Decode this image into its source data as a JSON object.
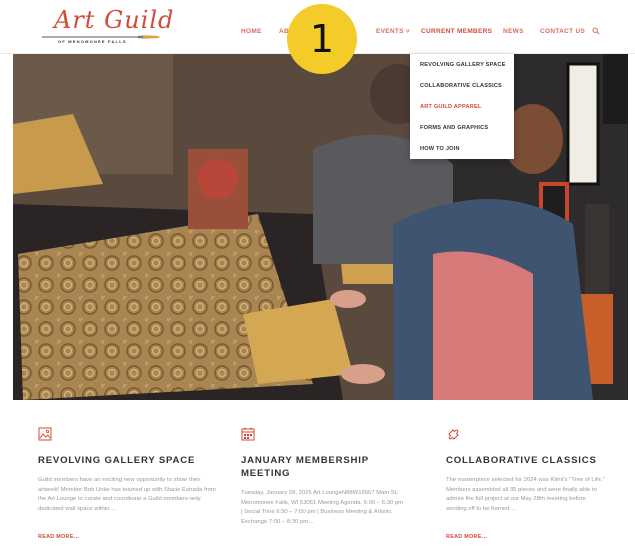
{
  "logo": {
    "title": "Art Guild",
    "subtitle": "OF MENOMONEE FALLS"
  },
  "annotation": {
    "marker": "1"
  },
  "nav": {
    "items": [
      {
        "label": "HOME"
      },
      {
        "label": "AB"
      },
      {
        "label": "EVENTS ˅"
      },
      {
        "label": "CURRENT MEMBERS"
      },
      {
        "label": "NEWS"
      },
      {
        "label": "CONTACT US"
      }
    ],
    "search_icon": "search-icon"
  },
  "dropdown": {
    "items": [
      {
        "label": "REVOLVING GALLERY SPACE"
      },
      {
        "label": "COLLABORATIVE CLASSICS"
      },
      {
        "label": "ART GUILD APPAREL"
      },
      {
        "label": "FORMS AND GRAPHICS"
      },
      {
        "label": "HOW TO JOIN"
      }
    ]
  },
  "features": [
    {
      "icon": "image-icon",
      "title": "REVOLVING GALLERY SPACE",
      "text": "Guild members have an exciting new opportunity to show their artwork! Member Bob Unke has teamed up with Stacie Estrada from the Art Lounge to curate and coordinate a Guild members-only dedicated wall space within…",
      "more": "READ MORE…"
    },
    {
      "icon": "calendar-icon",
      "title": "JANUARY MEMBERSHIP MEETING",
      "text": "Tuesday, January 28, 2025 Art LoungeN88W16567 Main St, Menomonee Falls, WI 53051 Meeting Agenda: 6:00 – 6:30 pm | Social Time 6:30 – 7:00 pm | Business Meeting & Artistic Exchange 7:00 – 8:30 pm…",
      "more": ""
    },
    {
      "icon": "puzzle-icon",
      "title": "COLLABORATIVE CLASSICS",
      "text": "The masterpiece selected for 2024 was Klimt's \"Tree of Life.\" Members assembled all 35 pieces and were finally able to admire the full project at our May 28th meeting before sending off to be framed…",
      "more": "READ MORE…"
    }
  ],
  "colors": {
    "accent": "#d24b3a",
    "badge": "#f4cc2a"
  }
}
